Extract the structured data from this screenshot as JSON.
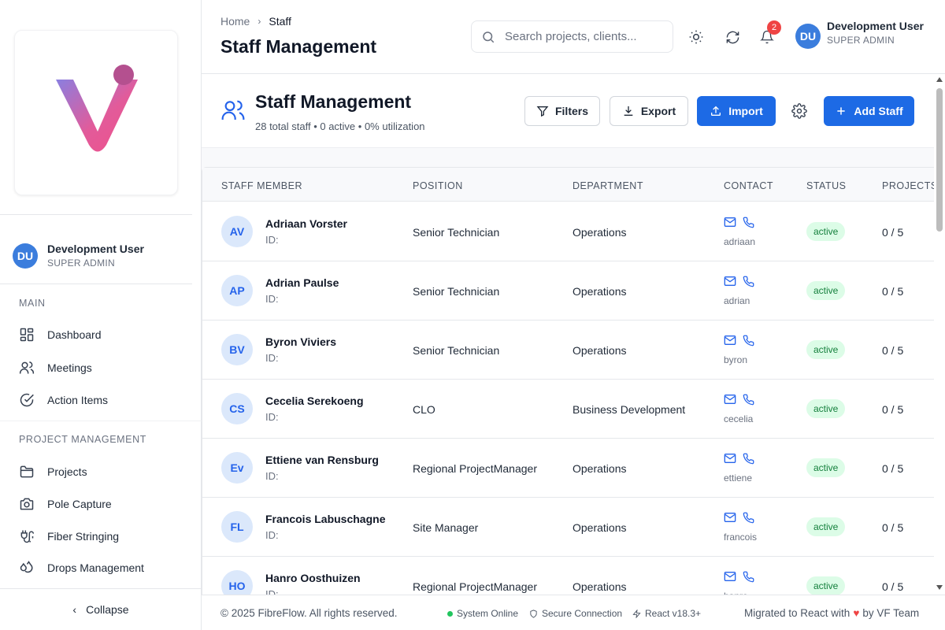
{
  "sidebar": {
    "user": {
      "initials": "DU",
      "name": "Development User",
      "role": "SUPER ADMIN"
    },
    "sections": [
      {
        "title": "MAIN",
        "items": [
          {
            "label": "Dashboard",
            "icon": "dashboard-icon"
          },
          {
            "label": "Meetings",
            "icon": "users-icon"
          },
          {
            "label": "Action Items",
            "icon": "check-circle-icon"
          }
        ]
      },
      {
        "title": "PROJECT MANAGEMENT",
        "items": [
          {
            "label": "Projects",
            "icon": "folder-icon"
          },
          {
            "label": "Pole Capture",
            "icon": "camera-icon"
          },
          {
            "label": "Fiber Stringing",
            "icon": "cable-icon"
          },
          {
            "label": "Drops Management",
            "icon": "droplets-icon"
          }
        ]
      }
    ],
    "collapse_label": "Collapse"
  },
  "header": {
    "breadcrumb": [
      "Home",
      "Staff"
    ],
    "title": "Staff Management",
    "search_placeholder": "Search projects, clients...",
    "notification_count": "2",
    "user": {
      "initials": "DU",
      "name": "Development User",
      "role": "SUPER ADMIN"
    }
  },
  "page": {
    "title": "Staff Management",
    "subtitle": "28 total staff • 0 active • 0% utilization",
    "buttons": {
      "filters": "Filters",
      "export": "Export",
      "import": "Import",
      "add": "Add Staff"
    }
  },
  "table": {
    "columns": [
      "STAFF MEMBER",
      "POSITION",
      "DEPARTMENT",
      "CONTACT",
      "STATUS",
      "PROJECTS"
    ],
    "rows": [
      {
        "initials": "AV",
        "name": "Adriaan Vorster",
        "id": "ID:",
        "position": "Senior Technician",
        "department": "Operations",
        "contact": "adriaan",
        "status": "active",
        "projects": "0 / 5"
      },
      {
        "initials": "AP",
        "name": "Adrian Paulse",
        "id": "ID:",
        "position": "Senior Technician",
        "department": "Operations",
        "contact": "adrian",
        "status": "active",
        "projects": "0 / 5"
      },
      {
        "initials": "BV",
        "name": "Byron Viviers",
        "id": "ID:",
        "position": "Senior Technician",
        "department": "Operations",
        "contact": "byron",
        "status": "active",
        "projects": "0 / 5"
      },
      {
        "initials": "CS",
        "name": "Cecelia Serekoeng",
        "id": "ID:",
        "position": "CLO",
        "department": "Business Development",
        "contact": "cecelia",
        "status": "active",
        "projects": "0 / 5"
      },
      {
        "initials": "Ev",
        "name": "Ettiene van Rensburg",
        "id": "ID:",
        "position": "Regional ProjectManager",
        "department": "Operations",
        "contact": "ettiene",
        "status": "active",
        "projects": "0 / 5"
      },
      {
        "initials": "FL",
        "name": "Francois Labuschagne",
        "id": "ID:",
        "position": "Site Manager",
        "department": "Operations",
        "contact": "francois",
        "status": "active",
        "projects": "0 / 5"
      },
      {
        "initials": "HO",
        "name": "Hanro Oosthuizen",
        "id": "ID:",
        "position": "Regional ProjectManager",
        "department": "Operations",
        "contact": "hanro",
        "status": "active",
        "projects": "0 / 5"
      }
    ]
  },
  "footer": {
    "copyright": "© 2025 FibreFlow. All rights reserved.",
    "system": "System Online",
    "secure": "Secure Connection",
    "react": "React v18.3+",
    "migrated_prefix": "Migrated to React with",
    "migrated_suffix": "by VF Team"
  },
  "colors": {
    "accent": "#1d6ae5",
    "status_active_bg": "#dcfce7",
    "status_active_text": "#15803d",
    "badge": "#ef4444"
  }
}
